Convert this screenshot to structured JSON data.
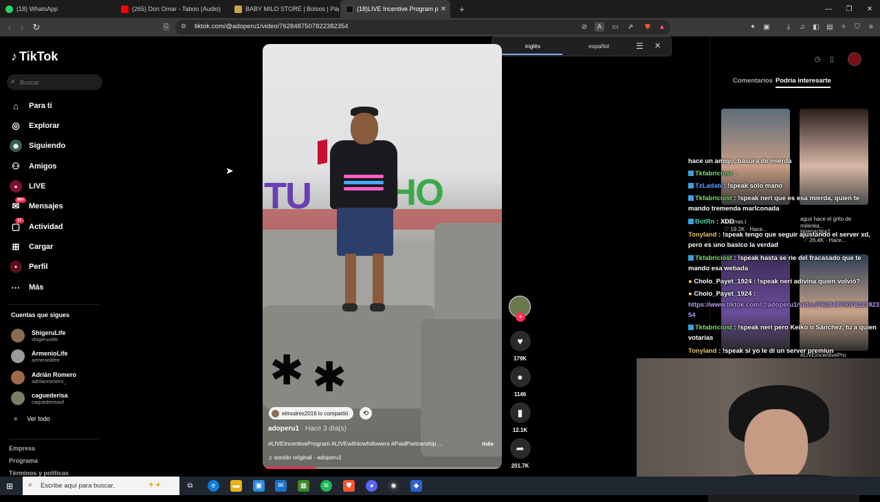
{
  "browser": {
    "tabs": [
      {
        "label": "(18) WhatsApp",
        "color": "#25d366"
      },
      {
        "label": "(265) Don Omar - Taboo (Audio)",
        "color": "#ff0000"
      },
      {
        "label": "BABY MILO STORE | Bolsos | Página o",
        "color": "#c8a24a"
      },
      {
        "label": "(18)LIVE Incentive Program p",
        "color": "#111111"
      }
    ],
    "new_tab": "+",
    "url": "tiktok.com/@adoperu1/video/7628487507822382354"
  },
  "translate": {
    "source_lang": "inglés",
    "target_lang": "español"
  },
  "tiktok": {
    "logo": "TikTok",
    "search_placeholder": "Buscar",
    "nav": [
      {
        "label": "Para ti",
        "icon": "home-icon"
      },
      {
        "label": "Explorar",
        "icon": "compass-icon"
      },
      {
        "label": "Siguiendo",
        "icon": "following-icon"
      },
      {
        "label": "Amigos",
        "icon": "friends-icon"
      },
      {
        "label": "LIVE",
        "icon": "live-icon"
      },
      {
        "label": "Mensajes",
        "icon": "messages-icon",
        "badge": "99+"
      },
      {
        "label": "Actividad",
        "icon": "activity-icon",
        "badge": "17"
      },
      {
        "label": "Cargar",
        "icon": "upload-icon"
      },
      {
        "label": "Perfil",
        "icon": "profile-icon"
      },
      {
        "label": "Más",
        "icon": "more-icon"
      }
    ],
    "following_title": "Cuentas que sigues",
    "following": [
      {
        "name": "ShigeruLife",
        "handle": "shigeruulife"
      },
      {
        "name": "ArmenioLife",
        "handle": "armeniolifee"
      },
      {
        "name": "Adrián Romero",
        "handle": "adrilanromero_"
      },
      {
        "name": "caguederisa",
        "handle": "caguederisaof"
      }
    ],
    "see_all": "Ver todo",
    "footer": [
      "Empresa",
      "Programa",
      "Términos y políticas"
    ]
  },
  "video": {
    "repost_text": "elmodres2016 lo compartió",
    "author": "adoperu1",
    "ago": "· Hace 3 día(s)",
    "caption": "#LIVEIncentiveProgram #LIVEwithlowfollowers #PaidPartnership ...",
    "more": "más",
    "sound": "♫  sonido original - adoperu1",
    "progress": 0.22
  },
  "actions": {
    "likes": "179K",
    "comments": "1146",
    "saves": "12.1K",
    "shares": "201.7K"
  },
  "right_panel": {
    "tab_comments": "Comentarios",
    "tab_suggested": "Podría interesarte",
    "thumbs": [
      {
        "caption": "hace un amigo, basura de mierda",
        "user": "alesanas.t",
        "likes": "19.2K",
        "ago": "Hace..."
      },
      {
        "caption": "agus hace el grito de milenka...",
        "user": "jimenaclips1",
        "likes": "26.4K",
        "ago": "Hace..."
      },
      {
        "caption": "",
        "user": "",
        "likes": "",
        "ago": ""
      },
      {
        "caption": "#LIVEIncentivePro",
        "user": "",
        "likes": "",
        "ago": ""
      }
    ]
  },
  "chat": [
    {
      "user": "",
      "text": "hace un amigo, basura de mierda"
    },
    {
      "user": "Tkfabriciost",
      "text": ":"
    },
    {
      "user": "TzLadate",
      "text": ": !speak solo mano"
    },
    {
      "user": "Tkfabriciost",
      "text": ": !speak neri que es esa mierda, quien te mando tremenda marlconada"
    },
    {
      "user": "BotRn",
      "text": ": XDD"
    },
    {
      "user": "Tonyland",
      "text": ": !speak tengo que seguir ajustando el server xd, pero es uno basico la verdad"
    },
    {
      "user": "Tkfabriciost",
      "text": ": !speak hasta se rie del fracasado que te mando esa webada"
    },
    {
      "user": "Cholo_Payet_1924",
      "text": ": !speak neri adivina quien volvió?"
    },
    {
      "user": "Cholo_Payet_1924",
      "text": ":"
    },
    {
      "user": "",
      "text": "https://www.tiktok.com/@adoperu1/video/7628487507822382354"
    },
    {
      "user": "Tkfabriciost",
      "text": ": !speak neri pero Keiko o Sánchez, tu a quien votarias"
    },
    {
      "user": "Tonyland",
      "text": ": !speak si yo le di un server premiun"
    }
  ],
  "taskbar": {
    "search_placeholder": "Escribe aquí para buscar."
  }
}
